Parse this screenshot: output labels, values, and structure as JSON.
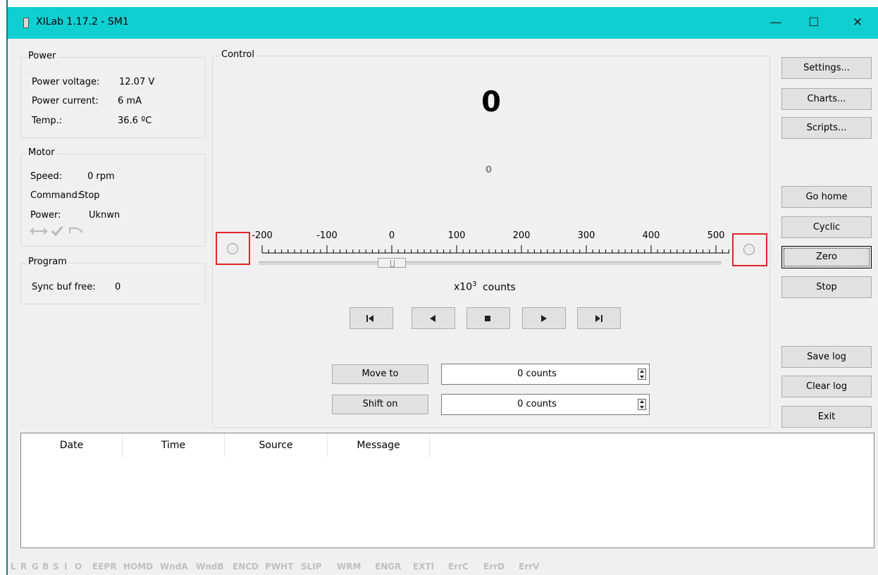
{
  "window": {
    "title": "XILab 1.17.2 - SM1",
    "minimize": "—",
    "maximize": "☐",
    "close": "✕"
  },
  "power": {
    "title": "Power",
    "voltage_label": "Power voltage:",
    "voltage_value": "12.07 V",
    "current_label": "Power current:",
    "current_value": "6 mA",
    "temp_label": "Temp.:",
    "temp_value": "36.6 ºC"
  },
  "motor": {
    "title": "Motor",
    "speed_label": "Speed:",
    "speed_value": "0  rpm",
    "command_label": "Command:",
    "command_value": "Stop",
    "power_label": "Power:",
    "power_value": "Uknwn"
  },
  "program": {
    "title": "Program",
    "sync_label": "Sync buf free:",
    "sync_value": "0"
  },
  "control": {
    "title": "Control",
    "position": "0",
    "encoder": "0",
    "scale_ticks": [
      "-200",
      "-100",
      "0",
      "100",
      "200",
      "300",
      "400",
      "500"
    ],
    "units_prefix": "x10",
    "units_exp": "3",
    "units_suffix": "counts",
    "slider_fraction": 0.288,
    "move_to_label": "Move to",
    "move_to_value": "0 counts",
    "shift_on_label": "Shift on",
    "shift_on_value": "0 counts"
  },
  "buttons": {
    "settings": "Settings...",
    "charts": "Charts...",
    "scripts": "Scripts...",
    "go_home": "Go home",
    "cyclic": "Cyclic",
    "zero": "Zero",
    "stop": "Stop",
    "save_log": "Save log",
    "clear_log": "Clear log",
    "exit": "Exit"
  },
  "log": {
    "columns": [
      "Date",
      "Time",
      "Source",
      "Message"
    ]
  },
  "statusbar": [
    "L",
    "R",
    "G",
    "B",
    "S",
    "I",
    "O",
    "EEPR",
    "HOMD",
    "WndA",
    "WndB",
    "ENCD",
    "PWHT",
    "SLIP",
    "WRM",
    "ENGR",
    "EXTI",
    "ErrC",
    "ErrD",
    "ErrV"
  ]
}
